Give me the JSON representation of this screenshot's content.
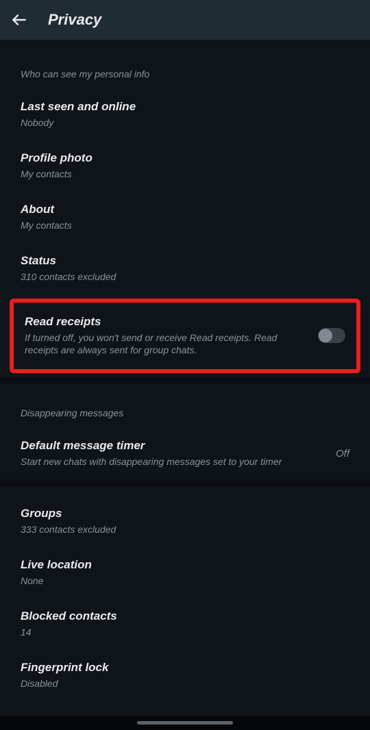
{
  "header": {
    "title": "Privacy"
  },
  "sections": {
    "personal_info": {
      "header": "Who can see my personal info",
      "items": [
        {
          "title": "Last seen and online",
          "subtitle": "Nobody"
        },
        {
          "title": "Profile photo",
          "subtitle": "My contacts"
        },
        {
          "title": "About",
          "subtitle": "My contacts"
        },
        {
          "title": "Status",
          "subtitle": "310 contacts excluded"
        }
      ],
      "read_receipts": {
        "title": "Read receipts",
        "subtitle": "If turned off, you won't send or receive Read receipts. Read receipts are always sent for group chats.",
        "enabled": false
      }
    },
    "disappearing": {
      "header": "Disappearing messages",
      "timer": {
        "title": "Default message timer",
        "subtitle": "Start new chats with disappearing messages set to your timer",
        "value": "Off"
      }
    },
    "other": [
      {
        "title": "Groups",
        "subtitle": "333 contacts excluded"
      },
      {
        "title": "Live location",
        "subtitle": "None"
      },
      {
        "title": "Blocked contacts",
        "subtitle": "14"
      },
      {
        "title": "Fingerprint lock",
        "subtitle": "Disabled"
      }
    ]
  }
}
